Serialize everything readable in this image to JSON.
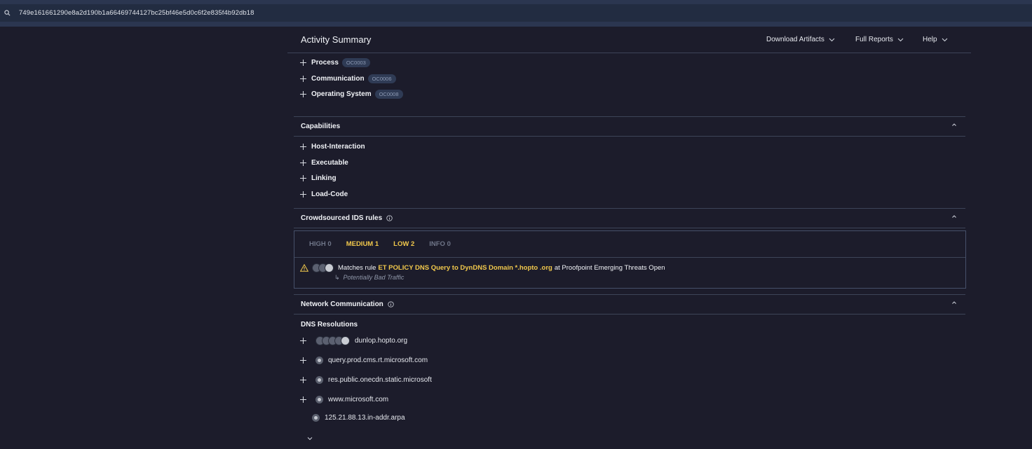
{
  "search": {
    "hash": "749e161661290e8a2d190b1a66469744127bc25bf46e5d0c6f2e835f4b92db18",
    "icon": "search-icon"
  },
  "header": {
    "title": "Activity Summary",
    "menus": [
      "Download Artifacts",
      "Full Reports",
      "Help"
    ]
  },
  "activity": [
    {
      "label": "Process",
      "tag": "OC0003"
    },
    {
      "label": "Communication",
      "tag": "OC0006"
    },
    {
      "label": "Operating System",
      "tag": "OC0008"
    }
  ],
  "capabilities": {
    "title": "Capabilities",
    "items": [
      "Host-Interaction",
      "Executable",
      "Linking",
      "Load-Code"
    ]
  },
  "ids": {
    "title": "Crowdsourced IDS rules",
    "severities": [
      {
        "label": "HIGH 0",
        "color": "#6f7689"
      },
      {
        "label": "MEDIUM 1",
        "color": "#f2c94c"
      },
      {
        "label": "LOW 2",
        "color": "#f2c94c"
      },
      {
        "label": "INFO 0",
        "color": "#6f7689"
      }
    ],
    "rule": {
      "prefix": "Matches rule",
      "name": "ET POLICY DNS Query to DynDNS Domain *.hopto .org",
      "suffix": "at Proofpoint Emerging Threats Open",
      "category": "Potentially Bad Traffic",
      "arrow": "↳"
    }
  },
  "network": {
    "title": "Network Communication",
    "dns_title": "DNS Resolutions",
    "dns": [
      "dunlop.hopto.org",
      "query.prod.cms.rt.microsoft.com",
      "res.public.onecdn.static.microsoft",
      "www.microsoft.com",
      "125.21.88.13.in-addr.arpa"
    ]
  },
  "colors": {
    "accent": "#f2c94c",
    "background": "#1c1c2b",
    "border": "#3d4458"
  }
}
